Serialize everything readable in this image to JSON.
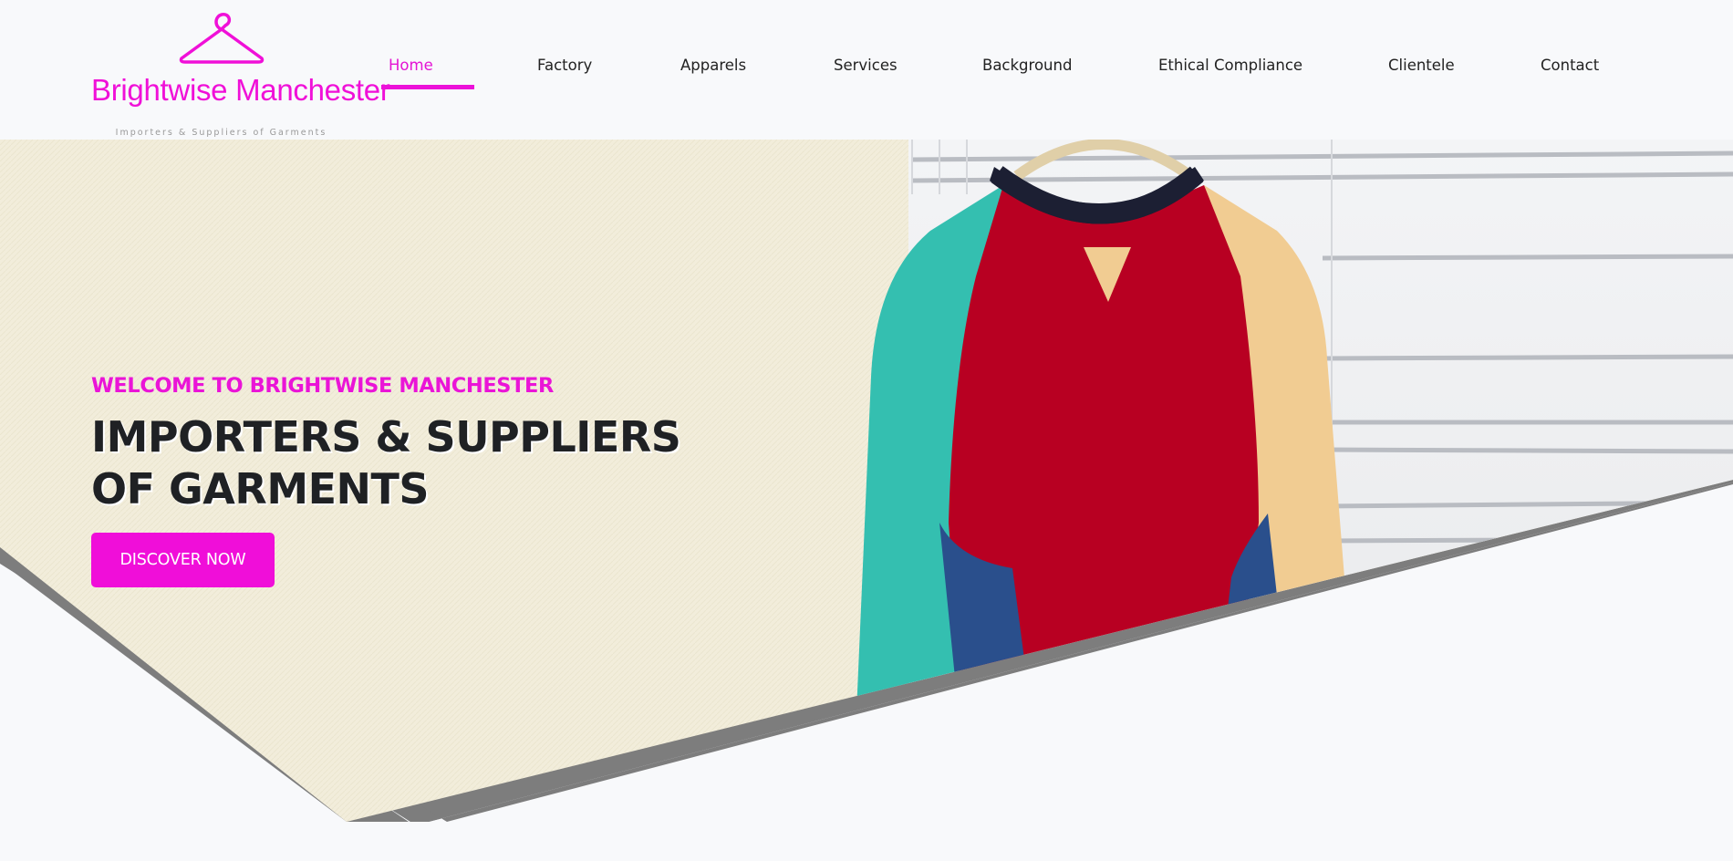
{
  "brand": {
    "name": "Brightwise Manchester",
    "tagline": "Importers & Suppliers of Garments",
    "accent_color": "#ec12d9",
    "logo_icon": "hanger-icon"
  },
  "nav": {
    "items": [
      {
        "label": "Home",
        "active": true
      },
      {
        "label": "Factory"
      },
      {
        "label": "Apparels"
      },
      {
        "label": "Services"
      },
      {
        "label": "Background"
      },
      {
        "label": "Ethical Compliance"
      },
      {
        "label": "Clientele"
      },
      {
        "label": "Contact"
      }
    ]
  },
  "hero": {
    "eyebrow": "WELCOME TO BRIGHTWISE MANCHESTER",
    "headline": "IMPORTERS & SUPPLIERS OF GARMENTS",
    "cta_label": "DISCOVER NOW",
    "image": "sweatshirt-on-hanger",
    "colors": {
      "panel": "#f2eddb",
      "shadow": "#7d7d7d",
      "heading": "#1f2124"
    }
  }
}
